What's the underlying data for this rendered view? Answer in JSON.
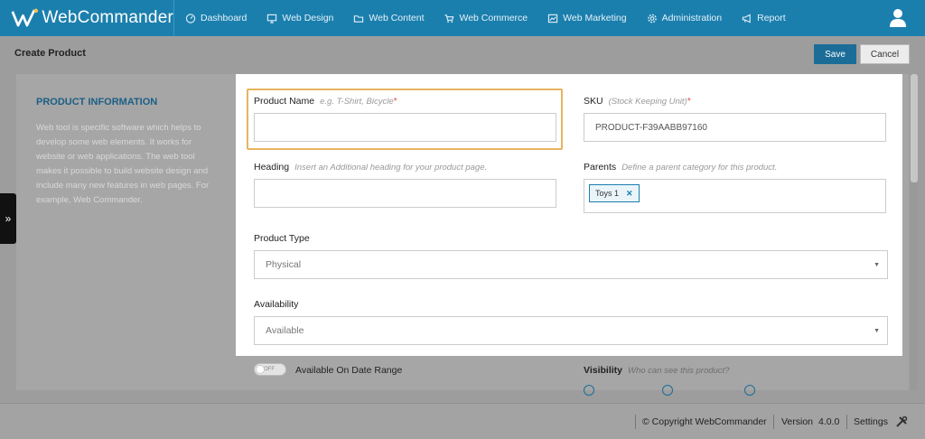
{
  "app": {
    "name": "WebCommander"
  },
  "nav": [
    {
      "label": "Dashboard",
      "icon": "dashboard-icon"
    },
    {
      "label": "Web Design",
      "icon": "monitor-icon"
    },
    {
      "label": "Web Content",
      "icon": "folder-icon"
    },
    {
      "label": "Web Commerce",
      "icon": "cart-icon"
    },
    {
      "label": "Web Marketing",
      "icon": "chart-icon"
    },
    {
      "label": "Administration",
      "icon": "gear-icon"
    },
    {
      "label": "Report",
      "icon": "megaphone-icon"
    }
  ],
  "page": {
    "title": "Create Product",
    "save_label": "Save",
    "cancel_label": "Cancel"
  },
  "info": {
    "title": "PRODUCT INFORMATION",
    "description": "Web tool is specific software which helps to develop some web elements. It works for website or web applications. The web tool makes it possible to build website design and include many new features in web pages. For example, Web Commander."
  },
  "form": {
    "product_name": {
      "label": "Product Name",
      "hint": "e.g. T-Shirt, Bicycle",
      "required": "*",
      "value": ""
    },
    "sku": {
      "label": "SKU",
      "hint": "(Stock Keeping Unit)",
      "required": "*",
      "value": "PRODUCT-F39AABB97160"
    },
    "heading": {
      "label": "Heading",
      "hint": "Insert an Additional heading for your product page.",
      "value": ""
    },
    "parents": {
      "label": "Parents",
      "hint": "Define a parent category for this product.",
      "tags": [
        "Toys 1"
      ]
    },
    "product_type": {
      "label": "Product Type",
      "value": "Physical"
    },
    "availability": {
      "label": "Availability",
      "value": "Available"
    },
    "date_range": {
      "label": "Available On Date Range",
      "toggle_text": "OFF"
    },
    "visibility": {
      "label": "Visibility",
      "hint": "Who can see this product?"
    }
  },
  "footer": {
    "copyright": "© Copyright WebCommander",
    "version_label": "Version",
    "version": "4.0.0",
    "settings": "Settings"
  },
  "colors": {
    "brand": "#1b7fae",
    "save": "#1b6d98",
    "focus": "#e8b460",
    "required": "#d9534f"
  }
}
